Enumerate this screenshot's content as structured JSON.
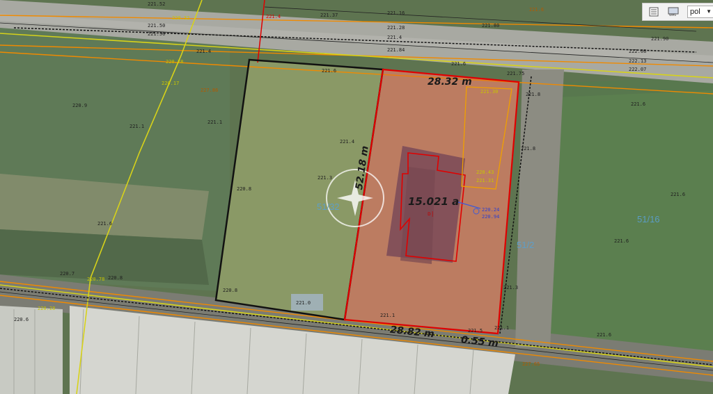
{
  "toolbar": {
    "lang_value": "pol",
    "icons": [
      "legend-icon",
      "wms-icon"
    ]
  },
  "measurements": {
    "top_edge": "28.32 m",
    "side_edge": "52.18 m",
    "bottom_edge": "28.82 m",
    "offset": "0.55 m",
    "area": "15.021 a",
    "area_symbol": "ᴅ|"
  },
  "parcels": {
    "left": "51/32",
    "right": "51/16",
    "road": "51/2"
  },
  "spot_heights": {
    "h01": "221.52",
    "h02": "221.50",
    "h03": "221.56",
    "h04": "221.6",
    "h05": "221.37",
    "h06": "221.80",
    "h07": "221.84",
    "h08": "221.28",
    "h09": "221.16",
    "h10": "221.4",
    "h11": "221.6",
    "h12": "221.75",
    "h13": "221.90",
    "h14": "222.08",
    "h15": "222.13",
    "h16": "222.07",
    "h17": "220.9",
    "h18": "221.1",
    "h19": "221.1",
    "h20": "221.6",
    "h21": "221.8",
    "h22": "221.6",
    "h23": "220.8",
    "h24": "221.3",
    "h25": "220.7",
    "h26": "220.8",
    "h27": "221.0",
    "h28": "221.1",
    "h29": "221.4",
    "h30": "221.3",
    "h31": "221.6",
    "h32": "220.6",
    "h33": "221.6",
    "h34": "221.5",
    "h35": "221.4",
    "h36": "220.8",
    "h37": "221.1",
    "h38": "221.8",
    "h39": "221.6"
  },
  "colored_labels": {
    "o1": "227.86",
    "o2": "221.6",
    "o3": "227.65",
    "o4": "220.17",
    "y1": "220.32",
    "y2": "220.78",
    "y3": "220.78",
    "y4": "221.30",
    "y5": "220.28",
    "y6": "220.43",
    "y7": "221.31",
    "b1": "220.24",
    "b2": "220.94",
    "r1": "221.4"
  },
  "colors": {
    "parcel_outline": "#111111",
    "building_outline": "#e00000",
    "utility_orange": "#f08a00",
    "utility_yellow": "#d7d21a",
    "survey_blue": "#3d5bd8",
    "field_green": "#4f6f45",
    "road_gray": "#9a9a92",
    "soil": "#b08060",
    "roof": "#735a60"
  }
}
